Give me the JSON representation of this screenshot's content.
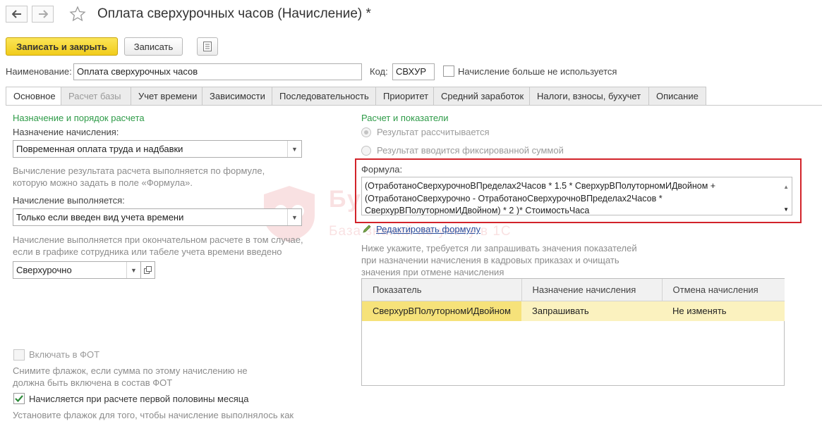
{
  "window": {
    "title": "Оплата сверхурочных часов (Начисление) *"
  },
  "toolbar": {
    "save_close_label": "Записать и закрыть",
    "save_label": "Записать"
  },
  "header": {
    "name_label": "Наименование:",
    "name_value": "Оплата сверхурочных часов",
    "code_label": "Код:",
    "code_value": "СВХУР",
    "not_used_label": "Начисление больше не используется"
  },
  "tabs": [
    {
      "label": "Основное"
    },
    {
      "label": "Расчет базы"
    },
    {
      "label": "Учет времени"
    },
    {
      "label": "Зависимости"
    },
    {
      "label": "Последовательность"
    },
    {
      "label": "Приоритет"
    },
    {
      "label": "Средний заработок"
    },
    {
      "label": "Налоги, взносы, бухучет"
    },
    {
      "label": "Описание"
    }
  ],
  "left": {
    "section_title": "Назначение и порядок расчета",
    "purpose_label": "Назначение начисления:",
    "purpose_value": "Повременная оплата труда и надбавки",
    "purpose_hint_1": "Вычисление результата расчета выполняется по формуле,",
    "purpose_hint_2": "которую можно задать в поле «Формула».",
    "execution_label": "Начисление выполняется:",
    "execution_value": "Только если введен вид учета времени",
    "execution_hint_1": "Начисление выполняется при окончательном расчете в том случае,",
    "execution_hint_2": "если в графике сотрудника или табеле учета времени введено",
    "time_type_value": "Сверхурочно",
    "fot_label": "Включать в ФОТ",
    "fot_hint_1": "Снимите флажок, если сумма по этому начислению не",
    "fot_hint_2": "должна быть включена в состав ФОТ",
    "first_half_label": "Начисляется при расчете первой половины месяца",
    "first_half_hint": "Установите флажок для того, чтобы начисление выполнялось как"
  },
  "right": {
    "section_title": "Расчет и показатели",
    "radio_calculated": "Результат рассчитывается",
    "radio_fixed": "Результат вводится фиксированной суммой",
    "formula_label": "Формула:",
    "formula_line_1": "(ОтработаноСверхурочноВПределах2Часов * 1.5 * СверхурВПолуторномИДвойном +",
    "formula_line_2": "(ОтработаноСверхурочно - ОтработаноСверхурочноВПределах2Часов *",
    "formula_line_3": "СверхурВПолуторномИДвойном) * 2 )* СтоимостьЧаса",
    "edit_formula_link": "Редактировать формулу",
    "indicators_hint_1": "Ниже укажите, требуется ли запрашивать значения показателей",
    "indicators_hint_2": "при назначении начисления в кадровых приказах и очищать",
    "indicators_hint_3": "значения при отмене начисления",
    "table": {
      "headers": [
        "Показатель",
        "Назначение начисления",
        "Отмена начисления"
      ],
      "rows": [
        [
          "СверхурВПолуторномИДвойном",
          "Запрашивать",
          "Не изменять"
        ]
      ]
    }
  },
  "watermark": {
    "brand": "БухЭксперт",
    "tagline": "База знаний по учёту в 1С"
  },
  "colors": {
    "accent_yellow": "#f1cc1b",
    "section_green": "#2e9b48",
    "highlight_red": "#d2232a",
    "link_blue": "#2b4f9d",
    "selected_row": "#fbf2bf"
  }
}
